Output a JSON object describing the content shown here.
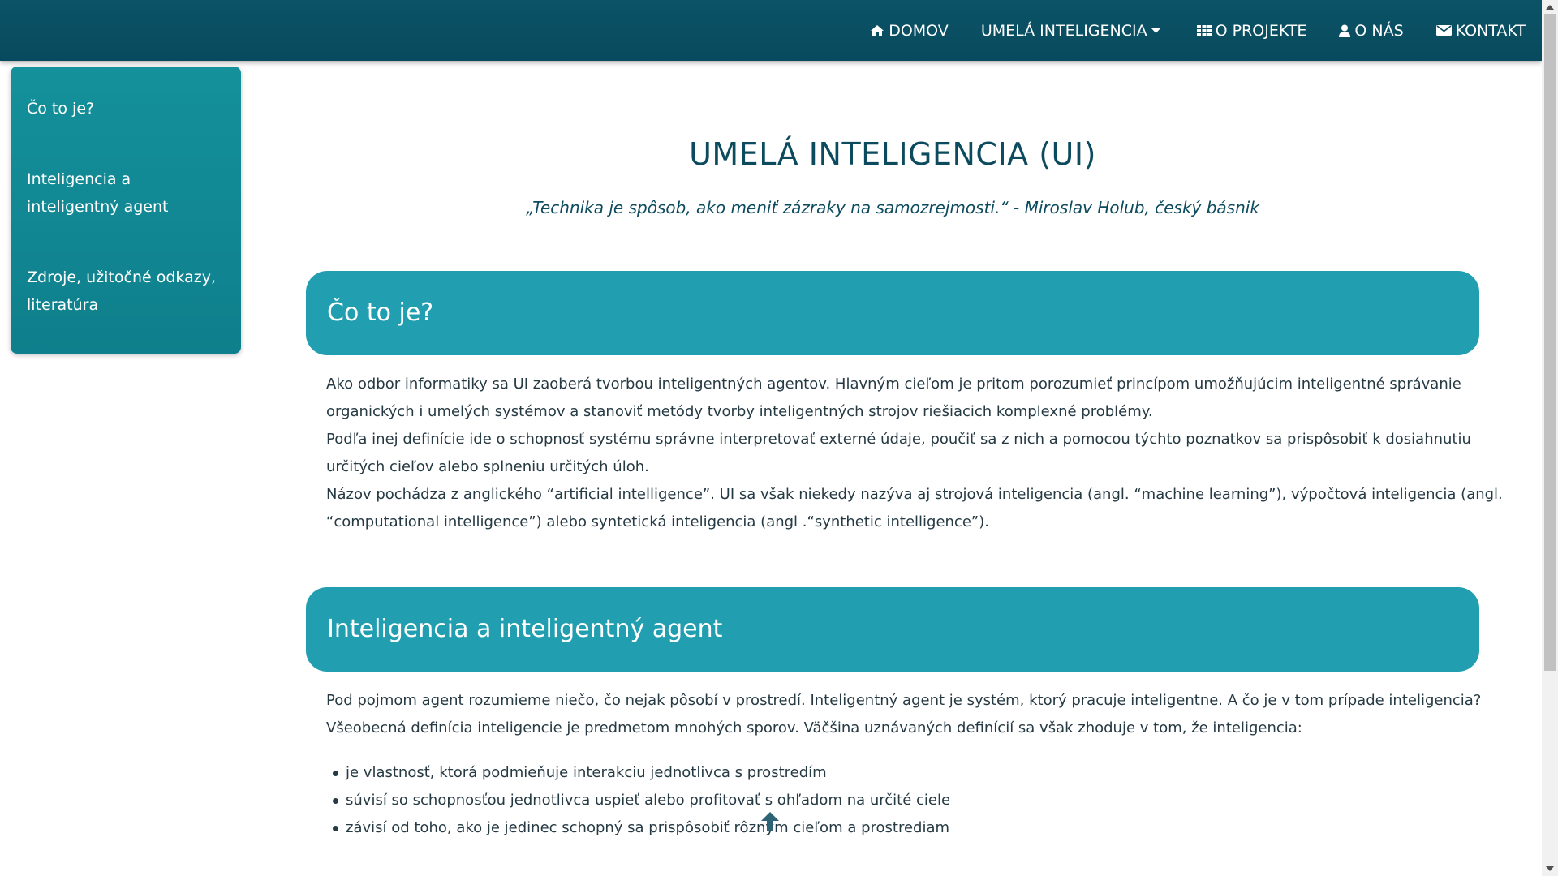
{
  "nav": {
    "items": [
      {
        "label": "DOMOV",
        "icon": "home-icon"
      },
      {
        "label": "UMELÁ INTELIGENCIA",
        "icon": "caret-down-icon"
      },
      {
        "label": "O PROJEKTE",
        "icon": "grid-icon"
      },
      {
        "label": "O NÁS",
        "icon": "user-icon"
      },
      {
        "label": "KONTAKT",
        "icon": "envelope-icon"
      }
    ]
  },
  "sidebar": {
    "items": [
      {
        "label": "Čo to je?"
      },
      {
        "label": "Inteligencia a inteligentný agent"
      },
      {
        "label": "Zdroje, užitočné odkazy, literatúra"
      }
    ]
  },
  "main": {
    "title": "UMELÁ INTELIGENCIA (UI)",
    "quote": "„Technika je spôsob, ako meniť zázraky na samozrejmosti.“ - Miroslav Holub, český básnik",
    "sections": [
      {
        "heading": "Čo to je?",
        "lines": [
          "Ako odbor informatiky sa UI zaoberá tvorbou inteligentných agentov. Hlavným cieľom je pritom porozumieť princípom umožňujúcim inteligentné správanie",
          "organických i umelých systémov a stanoviť metódy tvorby inteligentných strojov riešiacich komplexné problémy.",
          "Podľa inej definície ide o schopnosť systému správne interpretovať externé údaje, poučiť sa z nich a pomocou týchto poznatkov sa prispôsobiť k dosiahnutiu",
          "určitých cieľov alebo splneniu určitých úloh.",
          "Názov pochádza z anglického “artificial intelligence”. UI sa však niekedy nazýva aj strojová inteligencia (angl. “machine learning”), výpočtová inteligencia (angl.",
          "“computational intelligence”) alebo syntetická inteligencia (angl .“synthetic intelligence”)."
        ]
      },
      {
        "heading": "Inteligencia a inteligentný agent",
        "lines": [
          "Pod pojmom agent rozumieme niečo, čo nejak pôsobí v prostredí. Inteligentný agent je systém, ktorý pracuje inteligentne. A čo je v tom prípade inteligencia?",
          "Všeobecná definícia inteligencie je predmetom mnohých sporov. Väčšina uznávaných definícií sa však zhoduje v tom, že inteligencia:"
        ],
        "bullets": [
          "je vlastnosť, ktorá podmieňuje interakciu jednotlivca s prostredím",
          "súvisí so schopnosťou jednotlivca uspieť alebo profitovať s ohľadom na určité ciele",
          "závisí od toho, ako je jedinec schopný sa prispôsobiť rôznym cieľom a prostrediam"
        ]
      }
    ]
  },
  "colors": {
    "navbar": "#084a5d",
    "sidebar": "#14919b",
    "section_header": "#219fb0",
    "title": "#0c4a5e"
  }
}
